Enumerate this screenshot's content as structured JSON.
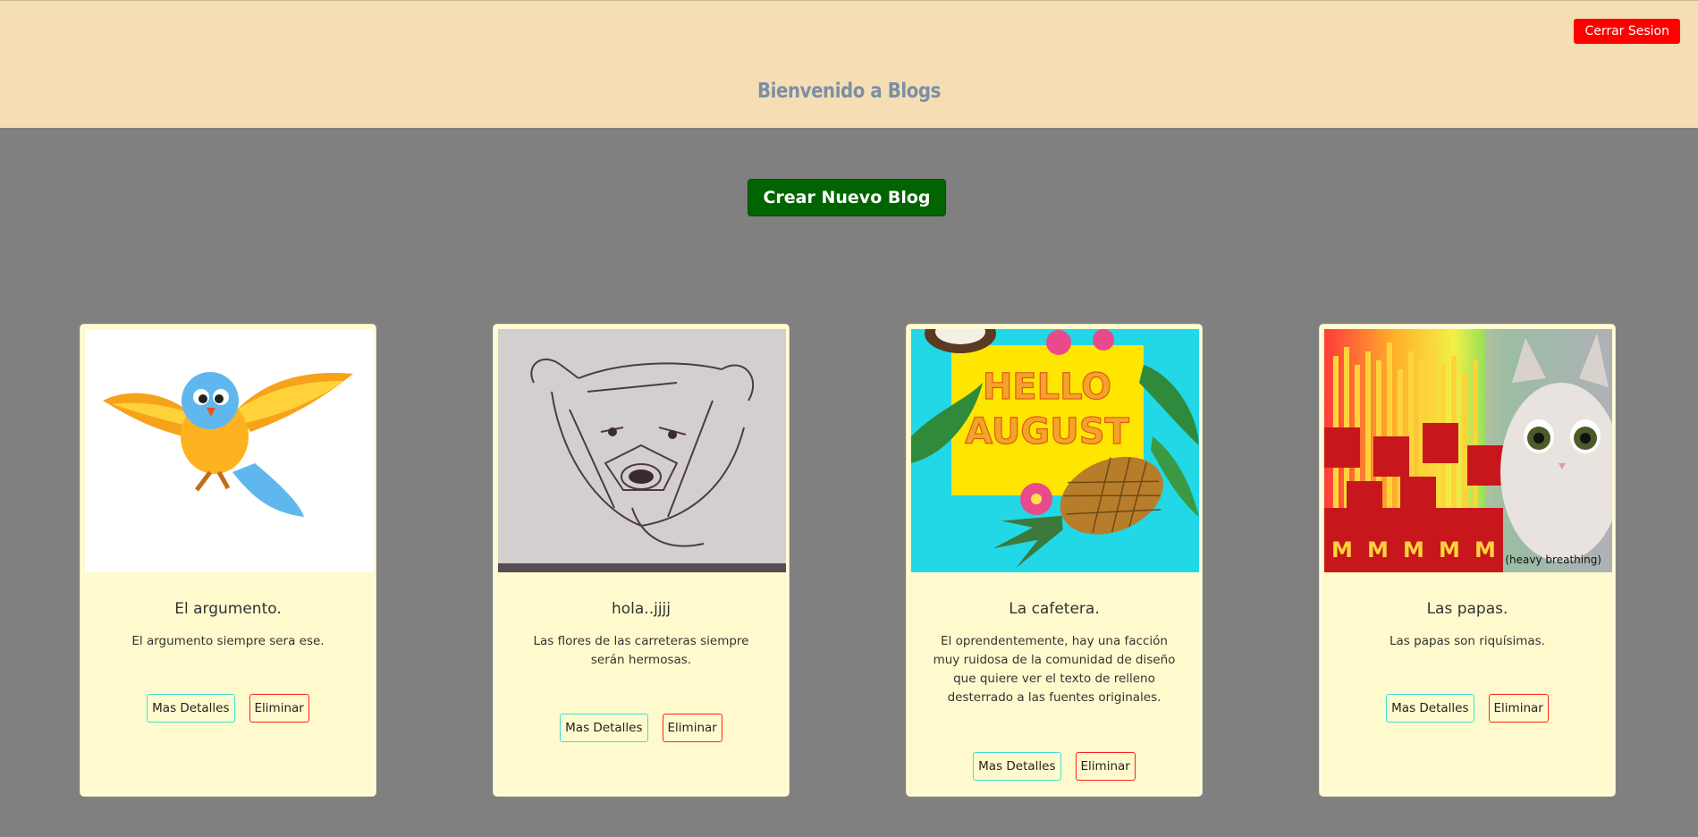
{
  "header": {
    "logout_label": "Cerrar Sesion",
    "title": "Bienvenido a Blogs"
  },
  "main": {
    "create_label": "Crear Nuevo Blog"
  },
  "blogs": [
    {
      "title": "El argumento.",
      "description": "El argumento siempre sera ese.",
      "image": "blue-bird-illustration",
      "details_label": "Mas Detalles",
      "delete_label": "Eliminar"
    },
    {
      "title": "hola..jjjj",
      "description": "Las flores de las carreteras siempre serán hermosas.",
      "image": "bear-pencil-sketch",
      "details_label": "Mas Detalles",
      "delete_label": "Eliminar"
    },
    {
      "title": "La cafetera.",
      "description": "El oprendentemente, hay una facción muy ruidosa de la comunidad de diseño que quiere ver el texto de relleno desterrado a las fuentes originales.",
      "image": "hello-august-pineapple",
      "image_text": "HELLO AUGUST",
      "details_label": "Mas Detalles",
      "delete_label": "Eliminar"
    },
    {
      "title": "Las papas.",
      "description": "Las papas son riquísimas.",
      "image": "cat-with-fries",
      "image_text": "(heavy breathing)",
      "details_label": "Mas Detalles",
      "delete_label": "Eliminar"
    }
  ],
  "colors": {
    "header_bg": "#f5deb3",
    "page_bg": "#808080",
    "logout_bg": "#ff0000",
    "create_bg": "#006400",
    "card_bg": "#fffacd",
    "details_border": "#40e0d0",
    "delete_border": "#ff2222"
  }
}
